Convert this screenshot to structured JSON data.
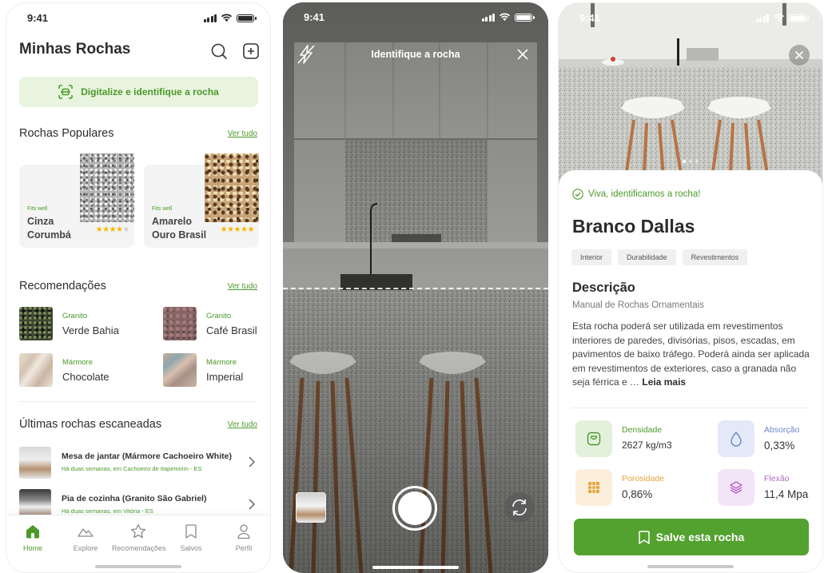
{
  "status_time": "9:41",
  "home": {
    "title": "Minhas Rochas",
    "scan_banner": "Digitalize e identifique a rocha",
    "popular": {
      "heading": "Rochas Populares",
      "see_all": "Ver tudo",
      "cards": [
        {
          "tag": "Fits well",
          "name": "Cinza Corumbá",
          "rating": 4
        },
        {
          "tag": "Fits well",
          "name": "Amarelo Ouro Brasil",
          "rating": 5
        }
      ]
    },
    "recommendations": {
      "heading": "Recomendações",
      "see_all": "Ver tudo",
      "items": [
        {
          "category": "Granito",
          "name": "Verde Bahia"
        },
        {
          "category": "Granito",
          "name": "Café Brasil"
        },
        {
          "category": "Mármore",
          "name": "Chocolate"
        },
        {
          "category": "Mármore",
          "name": "Imperial"
        }
      ]
    },
    "recent": {
      "heading": "Últimas rochas escaneadas",
      "see_all": "Ver tudo",
      "items": [
        {
          "title": "Mesa de jantar (Mármore Cachoeiro White)",
          "subtitle": "Há duas semanas, em Cachoeiro de Itapemirim - ES"
        },
        {
          "title": "Pia de cozinha (Granito São Gabriel)",
          "subtitle": "Há duas semanas, em Vitória - ES"
        }
      ]
    },
    "tabs": [
      {
        "label": "Home",
        "icon": "home-icon",
        "active": true
      },
      {
        "label": "Explore",
        "icon": "mountain-icon"
      },
      {
        "label": "Recomendações",
        "icon": "star-icon"
      },
      {
        "label": "Salvos",
        "icon": "bookmark-icon"
      },
      {
        "label": "Perfil",
        "icon": "user-icon"
      }
    ]
  },
  "camera": {
    "title": "Identifique a rocha"
  },
  "result": {
    "identified": "Viva, identificamos a rocha!",
    "name": "Branco Dallas",
    "chips": [
      "Interior",
      "Durabilidade",
      "Revestimentos"
    ],
    "description_heading": "Descrição",
    "description_source": "Manual de Rochas Ornamentais",
    "description_text": "Esta rocha poderá ser utilizada em revestimentos interiores de paredes, divisórias, pisos, escadas, em pavimentos de baixo tráfego. Poderá ainda ser aplicada em revestimentos de exteriores, caso a granada não seja férrica e …",
    "read_more": "Leia mais",
    "stats": [
      {
        "label": "Densidade",
        "value": "2627 kg/m3",
        "color": "#4c9a2a"
      },
      {
        "label": "Absorção",
        "value": "0,33%",
        "color": "#6b86c9"
      },
      {
        "label": "Porosidade",
        "value": "0,86%",
        "color": "#e3a33a"
      },
      {
        "label": "Flexão",
        "value": "11,4 Mpa",
        "color": "#b069c2"
      }
    ],
    "save_button": "Salve esta rocha"
  },
  "colors": {
    "brand_green": "#53a22f",
    "green_text": "#4c9a2a",
    "banner_bg": "#e8f4df"
  }
}
